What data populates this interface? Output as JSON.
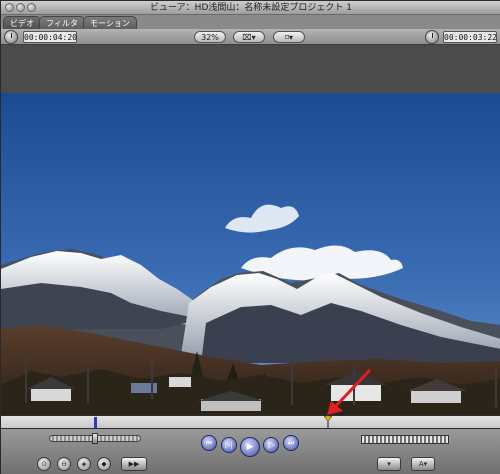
{
  "window": {
    "title": "ビューア：HD浅間山：名称未設定プロジェクト 1"
  },
  "tabs": [
    {
      "label": "ビデオ",
      "active": true
    },
    {
      "label": "フィルタ",
      "active": false
    },
    {
      "label": "モーション",
      "active": false
    }
  ],
  "toolbar": {
    "duration_timecode": "00:00:04:20",
    "zoom_label": "32%",
    "view_label": "⌧▾",
    "overlay_label": "⌑▾",
    "current_timecode": "00:00:03:22"
  },
  "scrubber": {
    "in_point_position": 0.185,
    "playhead_position": 0.654
  },
  "transport": {
    "prev_edit": "⏮",
    "play_in_out": "▷|",
    "play": "▶",
    "play_around": "|▷",
    "next_edit": "⏭"
  },
  "bottom_buttons": {
    "insert": "⊙",
    "overwrite": "⊖",
    "replace": "◈",
    "add_marker": "◆",
    "match_frame": "▶▶",
    "recent": "▾",
    "generator": "A▾"
  },
  "colors": {
    "accent_blue": "#3f4f9e",
    "marker_red": "#e02020",
    "sky_top": "#1f4f9a",
    "sky_bottom": "#5d8bc7"
  },
  "icons": {
    "duration": "clock-icon",
    "current": "clock-icon"
  }
}
